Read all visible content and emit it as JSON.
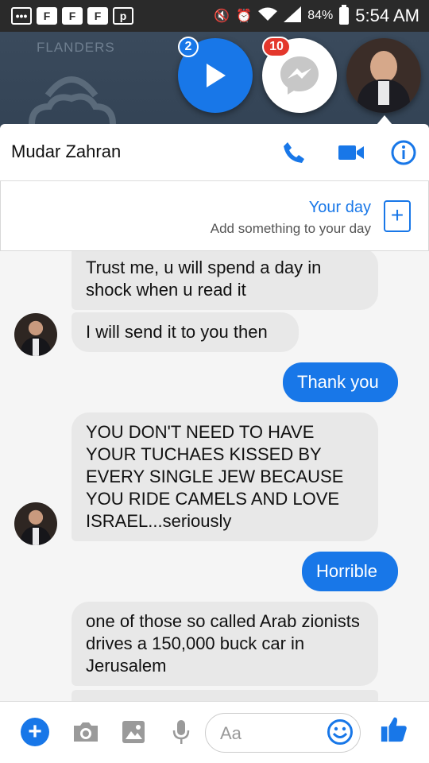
{
  "status_bar": {
    "notification_icons": [
      "F",
      "F",
      "F",
      "p"
    ],
    "battery": "84%",
    "time": "5:54 AM"
  },
  "background": {
    "widget_label": "FLANDERS"
  },
  "chat_heads": {
    "video_badge": "2",
    "messenger_badge": "10"
  },
  "header": {
    "contact_name": "Mudar Zahran"
  },
  "your_day": {
    "title": "Your day",
    "subtitle": "Add something to your day",
    "add_symbol": "+"
  },
  "messages": [
    {
      "from": "them",
      "text": "Trust me, u will spend a day in shock when u read it"
    },
    {
      "from": "them",
      "text": "I will send it to you then"
    },
    {
      "from": "me",
      "text": "Thank you"
    },
    {
      "from": "them",
      "text": "YOU DON'T NEED TO HAVE YOUR TUCHAES KISSED BY EVERY SINGLE JEW BECAUSE YOU RIDE CAMELS AND LOVE ISRAEL...seriously"
    },
    {
      "from": "me",
      "text": "Horrible"
    },
    {
      "from": "them",
      "text": "one of those so called Arab zionists drives a 150,000 buck car in Jerusalem"
    }
  ],
  "composer": {
    "placeholder": "Aa",
    "plus_symbol": "+"
  },
  "colors": {
    "accent": "#1877e8",
    "incoming_bubble": "#e8e8e8",
    "badge_red": "#e4372c"
  },
  "icons": [
    "phone-icon",
    "video-camera-icon",
    "info-icon",
    "camera-icon",
    "image-icon",
    "microphone-icon",
    "emoji-icon",
    "thumbs-up-icon",
    "play-icon",
    "messenger-icon"
  ]
}
